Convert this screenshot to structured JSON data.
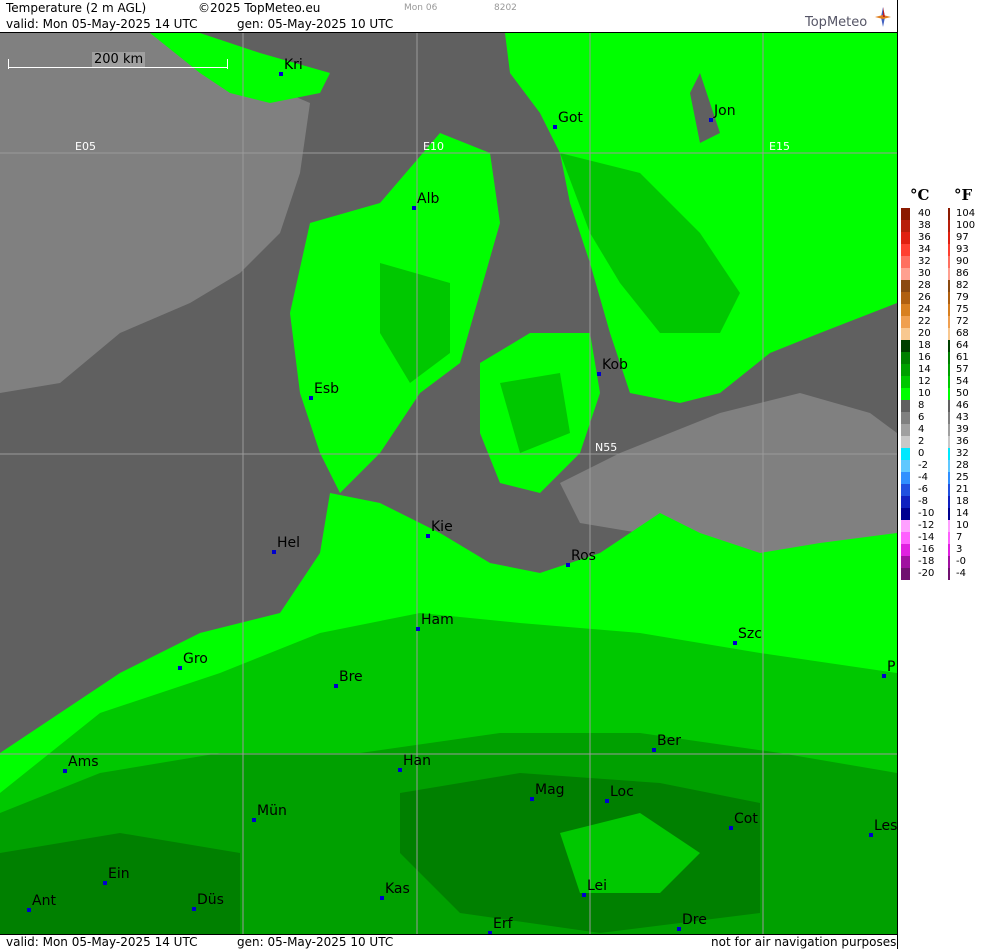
{
  "header": {
    "title": "Temperature (2 m AGL)",
    "copyright": "©2025 TopMeteo.eu",
    "day": "Mon 06",
    "code": "8202",
    "valid": "valid:  Mon  05-May-2025  14 UTC",
    "gen": "gen: 05-May-2025 10 UTC",
    "logo": "TopMeteo"
  },
  "footer": {
    "valid": "valid:  Mon  05-May-2025  14 UTC",
    "gen": "gen: 05-May-2025 10 UTC",
    "note": "not for air navigation purposes"
  },
  "scale_label": "200 km",
  "grid_labels": {
    "e05": "E05",
    "e10": "E10",
    "e15": "E15",
    "n55": "N55"
  },
  "cities": [
    {
      "code": "Kri"
    },
    {
      "code": "Got"
    },
    {
      "code": "Jon"
    },
    {
      "code": "Alb"
    },
    {
      "code": "Esb"
    },
    {
      "code": "Kob"
    },
    {
      "code": "Hel"
    },
    {
      "code": "Kie"
    },
    {
      "code": "Ros"
    },
    {
      "code": "Ham"
    },
    {
      "code": "Szc"
    },
    {
      "code": "Gro"
    },
    {
      "code": "Bre"
    },
    {
      "code": "P"
    },
    {
      "code": "Ber"
    },
    {
      "code": "Ams"
    },
    {
      "code": "Han"
    },
    {
      "code": "Mag"
    },
    {
      "code": "Loc"
    },
    {
      "code": "Mün"
    },
    {
      "code": "Cot"
    },
    {
      "code": "Les"
    },
    {
      "code": "Ein"
    },
    {
      "code": "Kas"
    },
    {
      "code": "Lei"
    },
    {
      "code": "Ant"
    },
    {
      "code": "Düs"
    },
    {
      "code": "Dre"
    },
    {
      "code": "Erf"
    }
  ],
  "legend": {
    "unit_c": "°C",
    "unit_f": "°F",
    "rows": [
      {
        "c": "40",
        "f": "104",
        "color": "#8b1a00"
      },
      {
        "c": "38",
        "f": "100",
        "color": "#b81e0a"
      },
      {
        "c": "36",
        "f": "97",
        "color": "#e02010"
      },
      {
        "c": "34",
        "f": "93",
        "color": "#ff4030"
      },
      {
        "c": "32",
        "f": "90",
        "color": "#ff7060"
      },
      {
        "c": "30",
        "f": "86",
        "color": "#ffa090"
      },
      {
        "c": "28",
        "f": "82",
        "color": "#8b4a10"
      },
      {
        "c": "26",
        "f": "79",
        "color": "#b06010"
      },
      {
        "c": "24",
        "f": "75",
        "color": "#d88020"
      },
      {
        "c": "22",
        "f": "72",
        "color": "#f0a050"
      },
      {
        "c": "20",
        "f": "68",
        "color": "#f8c890"
      },
      {
        "c": "18",
        "f": "64",
        "color": "#004000"
      },
      {
        "c": "16",
        "f": "61",
        "color": "#008000"
      },
      {
        "c": "14",
        "f": "57",
        "color": "#00a000"
      },
      {
        "c": "12",
        "f": "54",
        "color": "#00c800"
      },
      {
        "c": "10",
        "f": "50",
        "color": "#00ff00"
      },
      {
        "c": "8",
        "f": "46",
        "color": "#606060"
      },
      {
        "c": "6",
        "f": "43",
        "color": "#808080"
      },
      {
        "c": "4",
        "f": "39",
        "color": "#a0a0a0"
      },
      {
        "c": "2",
        "f": "36",
        "color": "#c8c8c8"
      },
      {
        "c": "0",
        "f": "32",
        "color": "#00e8ff"
      },
      {
        "c": "-2",
        "f": "28",
        "color": "#60c8ff"
      },
      {
        "c": "-4",
        "f": "25",
        "color": "#3090ff"
      },
      {
        "c": "-6",
        "f": "21",
        "color": "#2050e0"
      },
      {
        "c": "-8",
        "f": "18",
        "color": "#1020c0"
      },
      {
        "c": "-10",
        "f": "14",
        "color": "#000090"
      },
      {
        "c": "-12",
        "f": "10",
        "color": "#ffa0ff"
      },
      {
        "c": "-14",
        "f": "7",
        "color": "#ff60ff"
      },
      {
        "c": "-16",
        "f": "3",
        "color": "#e020e0"
      },
      {
        "c": "-18",
        "f": "-0",
        "color": "#a010a0"
      },
      {
        "c": "-20",
        "f": "-4",
        "color": "#701070"
      }
    ]
  },
  "colors": {
    "sea_dark": "#606060",
    "sea_light": "#808080",
    "land_bright": "#00ff00",
    "land_mid": "#00c800",
    "land_dark": "#00a000",
    "land_darker": "#008000",
    "city_marker": "#0000cc"
  }
}
